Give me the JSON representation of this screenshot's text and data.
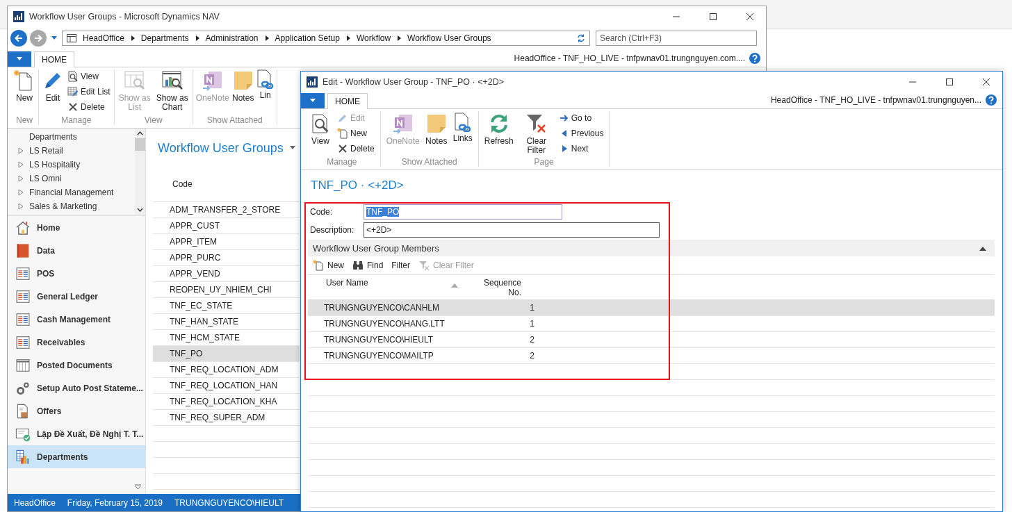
{
  "main_window": {
    "title": "Workflow User Groups - Microsoft Dynamics NAV",
    "breadcrumb": [
      "HeadOffice",
      "Departments",
      "Administration",
      "Application Setup",
      "Workflow",
      "Workflow User Groups"
    ],
    "search": {
      "placeholder": "Search (Ctrl+F3)"
    },
    "tabs": [
      {
        "label": "HOME",
        "selected": true
      }
    ],
    "connection": "HeadOffice - TNF_HO_LIVE - tnfpwnav01.trungnguyen.com....",
    "ribbon": [
      {
        "label": "New",
        "actions": [
          {
            "label": "New",
            "kind": "large",
            "disabled": false
          }
        ]
      },
      {
        "label": "Manage",
        "actions": [
          {
            "label": "Edit",
            "kind": "large",
            "disabled": false
          },
          {
            "label": "View",
            "kind": "small",
            "disabled": false
          },
          {
            "label": "Edit List",
            "kind": "small",
            "disabled": false
          },
          {
            "label": "Delete",
            "kind": "small",
            "disabled": false
          }
        ]
      },
      {
        "label": "View",
        "actions": [
          {
            "label": "Show as List",
            "kind": "large",
            "disabled": true
          },
          {
            "label": "Show as Chart",
            "kind": "large",
            "disabled": false
          }
        ]
      },
      {
        "label": "Show Attached",
        "actions": [
          {
            "label": "OneNote",
            "kind": "large",
            "disabled": true
          },
          {
            "label": "Notes",
            "kind": "large",
            "disabled": false
          },
          {
            "label": "Lin",
            "kind": "large",
            "disabled": false
          }
        ]
      }
    ],
    "tree": [
      {
        "label": "Departments",
        "kind": "heading"
      },
      {
        "label": "LS Retail",
        "kind": "node",
        "expanded": false
      },
      {
        "label": "LS Hospitality",
        "kind": "node",
        "expanded": false
      },
      {
        "label": "LS Omni",
        "kind": "node",
        "expanded": false
      },
      {
        "label": "Financial Management",
        "kind": "node",
        "expanded": false
      },
      {
        "label": "Sales & Marketing",
        "kind": "node",
        "expanded": false
      }
    ],
    "nav": [
      {
        "label": "Home",
        "selected": false
      },
      {
        "label": "Data",
        "selected": false
      },
      {
        "label": "POS",
        "selected": false
      },
      {
        "label": "General Ledger",
        "selected": false
      },
      {
        "label": "Cash Management",
        "selected": false
      },
      {
        "label": "Receivables",
        "selected": false
      },
      {
        "label": "Posted Documents",
        "selected": false
      },
      {
        "label": "Setup Auto Post Stateme...",
        "selected": false
      },
      {
        "label": "Offers",
        "selected": false
      },
      {
        "label": "Lập Đề Xuất, Đề Nghị T. T...",
        "selected": false
      },
      {
        "label": "Departments",
        "selected": true
      }
    ],
    "list": {
      "title": "Workflow User Groups",
      "columns": [
        "Code"
      ],
      "rows": [
        {
          "code": "ADM_TRANSFER_2_STORE",
          "selected": false
        },
        {
          "code": "APPR_CUST",
          "selected": false
        },
        {
          "code": "APPR_ITEM",
          "selected": false
        },
        {
          "code": "APPR_PURC",
          "selected": false
        },
        {
          "code": "APPR_VEND",
          "selected": false
        },
        {
          "code": "REOPEN_UY_NHIEM_CHI",
          "selected": false
        },
        {
          "code": "TNF_EC_STATE",
          "selected": false
        },
        {
          "code": "TNF_HAN_STATE",
          "selected": false
        },
        {
          "code": "TNF_HCM_STATE",
          "selected": false
        },
        {
          "code": "TNF_PO",
          "selected": true
        },
        {
          "code": "TNF_REQ_LOCATION_ADM",
          "selected": false
        },
        {
          "code": "TNF_REQ_LOCATION_HAN",
          "selected": false
        },
        {
          "code": "TNF_REQ_LOCATION_KHA",
          "selected": false
        },
        {
          "code": "TNF_REQ_SUPER_ADM",
          "selected": false
        }
      ]
    },
    "status_bar": [
      "HeadOffice",
      "Friday, February 15, 2019",
      "TRUNGNGUYENCO\\HIEULT"
    ]
  },
  "edit_window": {
    "title": "Edit - Workflow User Group - TNF_PO · <+2D>",
    "tabs": [
      {
        "label": "HOME",
        "selected": true
      }
    ],
    "connection": "HeadOffice - TNF_HO_LIVE - tnfpwnav01.trungnguyen...",
    "ribbon": [
      {
        "label": "Manage",
        "actions": [
          {
            "label": "View",
            "kind": "large",
            "disabled": false
          },
          {
            "label": "Edit",
            "kind": "small",
            "disabled": true
          },
          {
            "label": "New",
            "kind": "small",
            "disabled": false
          },
          {
            "label": "Delete",
            "kind": "small",
            "disabled": false
          }
        ]
      },
      {
        "label": "Show Attached",
        "actions": [
          {
            "label": "OneNote",
            "kind": "large",
            "disabled": true
          },
          {
            "label": "Notes",
            "kind": "large",
            "disabled": false
          },
          {
            "label": "Links",
            "kind": "large",
            "disabled": false
          }
        ]
      },
      {
        "label": "Page",
        "actions": [
          {
            "label": "Refresh",
            "kind": "large",
            "disabled": false
          },
          {
            "label": "Clear Filter",
            "kind": "large",
            "disabled": false
          },
          {
            "label": "Go to",
            "kind": "small",
            "disabled": false
          },
          {
            "label": "Previous",
            "kind": "small",
            "disabled": false
          },
          {
            "label": "Next",
            "kind": "small",
            "disabled": false
          }
        ]
      }
    ],
    "page_title": "TNF_PO · <+2D>",
    "fields": [
      {
        "label": "Code:",
        "value": "TNF_PO",
        "text_selected": true
      },
      {
        "label": "Description:",
        "value": "<+2D>",
        "text_selected": false
      }
    ],
    "members": {
      "title": "Workflow User Group Members",
      "expanded": true,
      "actions": [
        {
          "label": "New",
          "disabled": false
        },
        {
          "label": "Find",
          "disabled": false
        },
        {
          "label": "Filter",
          "disabled": false
        },
        {
          "label": "Clear Filter",
          "disabled": true
        }
      ],
      "columns": [
        {
          "label": "User Name"
        },
        {
          "label": "Sequence No."
        }
      ],
      "rows": [
        {
          "user_name": "TRUNGNGUYENCO\\CANHLM",
          "sequence_no": "1",
          "selected": true
        },
        {
          "user_name": "TRUNGNGUYENCO\\HANG.LTT",
          "sequence_no": "1",
          "selected": false
        },
        {
          "user_name": "TRUNGNGUYENCO\\HIEULT",
          "sequence_no": "2",
          "selected": false
        },
        {
          "user_name": "TRUNGNGUYENCO\\MAILTP",
          "sequence_no": "2",
          "selected": false
        }
      ]
    }
  }
}
